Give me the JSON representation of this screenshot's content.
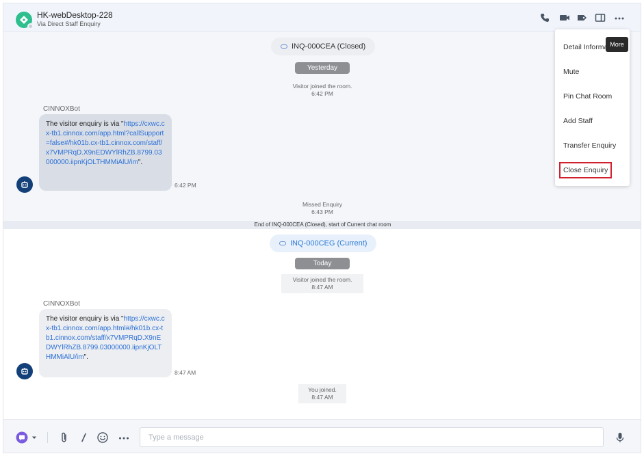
{
  "header": {
    "title": "HK-webDesktop-228",
    "subtitle": "Via Direct Staff Enquiry"
  },
  "history": {
    "inquiry_label": "INQ-000CEA (Closed)",
    "day_label": "Yesterday",
    "joined_text": "Visitor joined the room.",
    "joined_time": "6:42 PM",
    "sender": "CINNOXBot",
    "message_prefix": "The visitor enquiry is via \"",
    "message_link": "https://cxwc.cx-tb1.cinnox.com/app.html?callSupport=false#/hk01b.cx-tb1.cinnox.com/staff/x7VMPRqD.X9nEDWYlRhZB.8799.03000000.iipnKjOLTHMMiAlU/im",
    "message_suffix": "\".",
    "message_time": "6:42 PM",
    "missed_text": "Missed Enquiry",
    "missed_time": "6:43 PM"
  },
  "divider_text": "End of INQ-000CEA (Closed), start of Current chat room",
  "current": {
    "inquiry_label": "INQ-000CEG (Current)",
    "day_label": "Today",
    "joined_text": "Visitor joined the room.",
    "joined_time": "8:47 AM",
    "sender": "CINNOXBot",
    "message_prefix": "The visitor enquiry is via \"",
    "message_link": "https://cxwc.cx-tb1.cinnox.com/app.html#/hk01b.cx-tb1.cinnox.com/staff/x7VMPRqD.X9nEDWYlRhZB.8799.03000000.iipnKjOLTHMMiAlU/im",
    "message_suffix": "\".",
    "message_time": "8:47 AM",
    "you_joined_text": "You joined.",
    "you_joined_time": "8:47 AM"
  },
  "composer": {
    "placeholder": "Type a message"
  },
  "menu": {
    "items": [
      "Detail Information",
      "Mute",
      "Pin Chat Room",
      "Add Staff",
      "Transfer Enquiry",
      "Close Enquiry"
    ],
    "tooltip": "More"
  },
  "colors": {
    "accent": "#2b78d6",
    "bot_avatar": "#14407a",
    "room_avatar": "#2fbf8f",
    "highlight": "#d21f2e"
  },
  "icons": [
    "phone-icon",
    "video-icon",
    "tag-icon",
    "panel-icon",
    "more-icon",
    "chat-type-icon",
    "attach-icon",
    "slash-icon",
    "emoji-icon",
    "composer-more-icon",
    "mic-icon",
    "link-icon",
    "bot-icon"
  ]
}
